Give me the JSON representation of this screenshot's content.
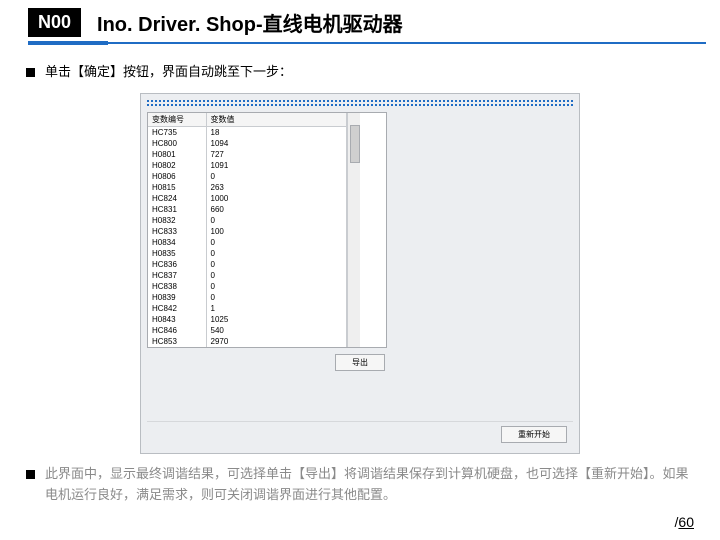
{
  "header": {
    "badge": "N00",
    "title": "Ino. Driver. Shop-直线电机驱动器"
  },
  "bullets": {
    "top_pre": "单击【确定】按钮，界面自动跳至下一步：",
    "bottom": "此界面中，显示最终调谐结果，可选择单击【导出】将调谐结果保存到计算机硬盘，也可选择【重新开始】。如果电机运行良好，满足需求，则可关闭调谐界面进行其他配置。"
  },
  "table": {
    "headers": [
      "变数编号",
      "变数值"
    ],
    "rows": [
      [
        "HC735",
        "18"
      ],
      [
        "HC800",
        "1094"
      ],
      [
        "H0801",
        "727"
      ],
      [
        "H0802",
        "1091"
      ],
      [
        "H0806",
        "0"
      ],
      [
        "H0815",
        "263"
      ],
      [
        "HC824",
        "1000"
      ],
      [
        "HC831",
        "660"
      ],
      [
        "H0832",
        "0"
      ],
      [
        "HC833",
        "100"
      ],
      [
        "H0834",
        "0"
      ],
      [
        "H0835",
        "0"
      ],
      [
        "HC836",
        "0"
      ],
      [
        "HC837",
        "0"
      ],
      [
        "HC838",
        "0"
      ],
      [
        "H0839",
        "0"
      ],
      [
        "HC842",
        "1"
      ],
      [
        "H0843",
        "1025"
      ],
      [
        "HC846",
        "540"
      ],
      [
        "HC853",
        "2970"
      ]
    ]
  },
  "buttons": {
    "export": "导出",
    "restart": "重新开始"
  },
  "pager": {
    "sep": "/",
    "total": "60"
  }
}
